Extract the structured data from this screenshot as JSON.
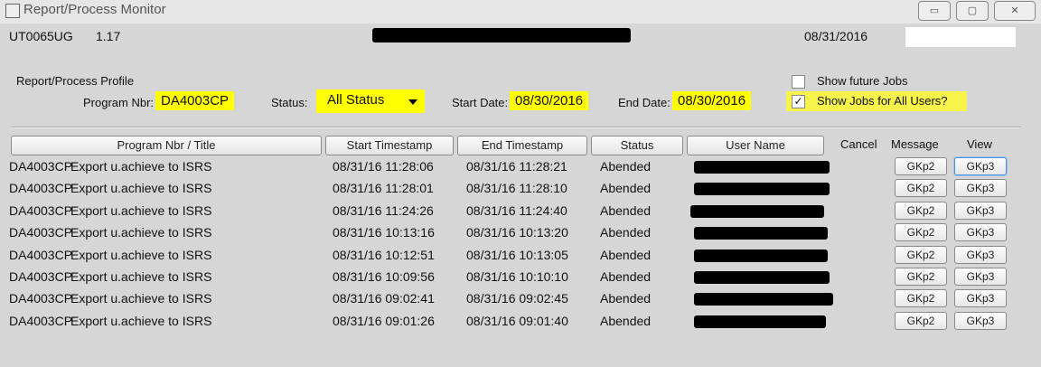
{
  "window": {
    "title": "Report/Process Monitor",
    "buttons": [
      "▭",
      "▢",
      "✕"
    ]
  },
  "header": {
    "form_id": "UT0065UG",
    "version": "1.17",
    "date": "08/31/2016"
  },
  "profile": {
    "section_label": "Report/Process Profile",
    "program_label": "Program Nbr:",
    "program_value": "DA4003CP",
    "status_label": "Status:",
    "status_value": "All Status",
    "start_label": "Start Date:",
    "start_value": "08/30/2016",
    "end_label": "End Date:",
    "end_value": "08/30/2016",
    "show_future_label": "Show future Jobs",
    "show_future_checked": false,
    "show_all_users_label": "Show Jobs for All Users?",
    "show_all_users_checked": true,
    "checkmark": "✓"
  },
  "table": {
    "columns": [
      "Program Nbr / Title",
      "Start Timestamp",
      "End Timestamp",
      "Status",
      "User Name",
      "Cancel",
      "Message",
      "View"
    ],
    "message_btn": "GKp2",
    "view_btn": "GKp3",
    "rows": [
      {
        "program": "DA4003CP",
        "title": "Export u.achieve to ISRS",
        "start": "08/31/16 11:28:06",
        "end": "08/31/16 11:28:21",
        "status": "Abended"
      },
      {
        "program": "DA4003CP",
        "title": "Export u.achieve to ISRS",
        "start": "08/31/16 11:28:01",
        "end": "08/31/16 11:28:10",
        "status": "Abended"
      },
      {
        "program": "DA4003CP",
        "title": "Export u.achieve to ISRS",
        "start": "08/31/16 11:24:26",
        "end": "08/31/16 11:24:40",
        "status": "Abended"
      },
      {
        "program": "DA4003CP",
        "title": "Export u.achieve to ISRS",
        "start": "08/31/16 10:13:16",
        "end": "08/31/16 10:13:20",
        "status": "Abended"
      },
      {
        "program": "DA4003CP",
        "title": "Export u.achieve to ISRS",
        "start": "08/31/16 10:12:51",
        "end": "08/31/16 10:13:05",
        "status": "Abended"
      },
      {
        "program": "DA4003CP",
        "title": "Export u.achieve to ISRS",
        "start": "08/31/16 10:09:56",
        "end": "08/31/16 10:10:10",
        "status": "Abended"
      },
      {
        "program": "DA4003CP",
        "title": "Export u.achieve to ISRS",
        "start": "08/31/16 09:02:41",
        "end": "08/31/16 09:02:45",
        "status": "Abended"
      },
      {
        "program": "DA4003CP",
        "title": "Export u.achieve to ISRS",
        "start": "08/31/16 09:01:26",
        "end": "08/31/16 09:01:40",
        "status": "Abended"
      }
    ]
  },
  "colors": {
    "highlight": "#ffff00",
    "background": "#d6d6d6",
    "redaction": "#000000"
  }
}
